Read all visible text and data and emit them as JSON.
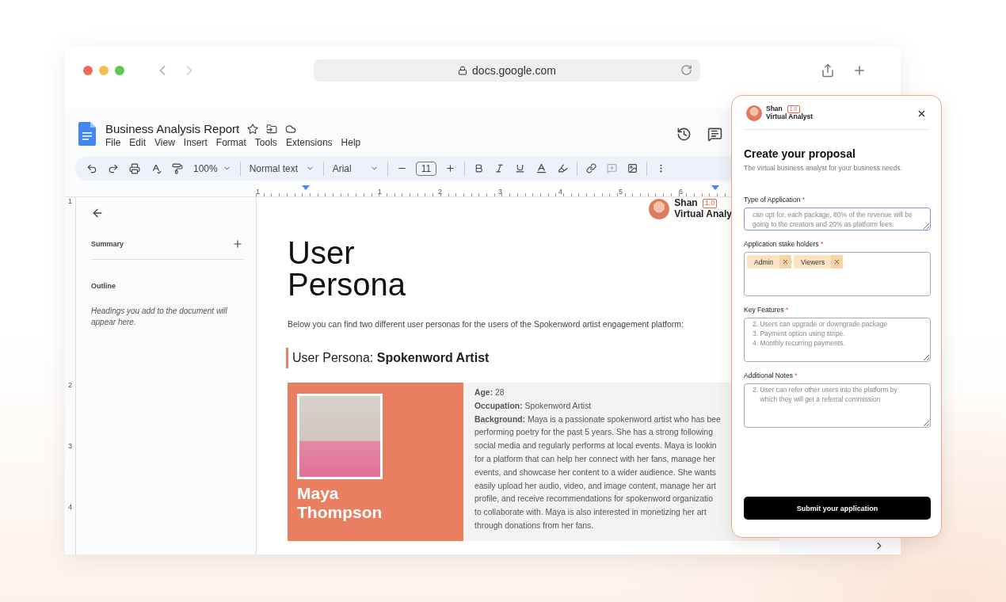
{
  "browser": {
    "url": "docs.google.com"
  },
  "document": {
    "title": "Business Analysis Report",
    "menu": [
      "File",
      "Edit",
      "View",
      "Insert",
      "Format",
      "Tools",
      "Extensions",
      "Help"
    ],
    "toolbar": {
      "zoom": "100%",
      "style": "Normal text",
      "font": "Arial",
      "font_size": "11"
    },
    "ruler": {
      "horizontal": [
        "1",
        "1",
        "2",
        "3",
        "4",
        "5",
        "6"
      ],
      "vertical": [
        "1",
        "2",
        "3",
        "4"
      ]
    },
    "outline": {
      "summary": "Summary",
      "outline": "Outline",
      "hint": "Headings you add to the document will appear here."
    },
    "page": {
      "logo": {
        "name": "Shan",
        "version": "1.0",
        "role": "Virtual Analy"
      },
      "heading": "User Persona",
      "intro": "Below you can find two different user personas for the users of the Spokenword artist engagement platform:",
      "persona_title": "User Persona: **Spokenword Artist**",
      "persona": {
        "name": "Maya Thompson",
        "details": [
          "**Age:** 28",
          "**Occupation:** Spokenword Artist"
        ],
        "background_lines": [
          "**Background:** Maya is a passionate spokenword artist who has bee",
          "performing poetry for the past 5 years. She has a strong following",
          "social media and regularly performs at local events. Maya is lookin",
          "for a platform that can help her connect with her fans, manage her",
          "events, and showcase her content to a wider audience. She wants",
          "easily upload her audio, video, and image content, manage her art",
          "profile, and receive recommendations for spokenword organizatio",
          "to collaborate with. Maya is also interested in monetizing her art",
          "through donations from her fans."
        ]
      }
    }
  },
  "panel": {
    "brand": {
      "name": "Shan",
      "version": "1.0",
      "role": "Virtual Analyst"
    },
    "title": "Create your proposal",
    "subtitle": "The virtual business analyst for your business needs.",
    "fields": [
      {
        "kind": "text",
        "label": "Type of Application",
        "required_mark": "*",
        "focused": true,
        "lines": [
          "can opt for, each package, 80% of the revenue will be",
          "going to the creators and 20% as platform fees."
        ]
      },
      {
        "kind": "tags",
        "label": "Application stake holders",
        "required_mark": "*",
        "focused": false,
        "tags": [
          "Admin",
          "Viewers"
        ]
      },
      {
        "kind": "text",
        "label": "Key Features",
        "required_mark": "*",
        "focused": false,
        "lines": [
          "2. Users can upgrade or downgrade package",
          "3. Payment option using stripe.",
          "4. Monthly recurring payments."
        ]
      },
      {
        "kind": "text",
        "label": "Additional Notes",
        "required_mark": "*",
        "focused": false,
        "lines": [
          "2. User can refer other users into the platform by",
          "    which they will get a referral commission"
        ]
      }
    ],
    "submit": "Submit your application"
  }
}
